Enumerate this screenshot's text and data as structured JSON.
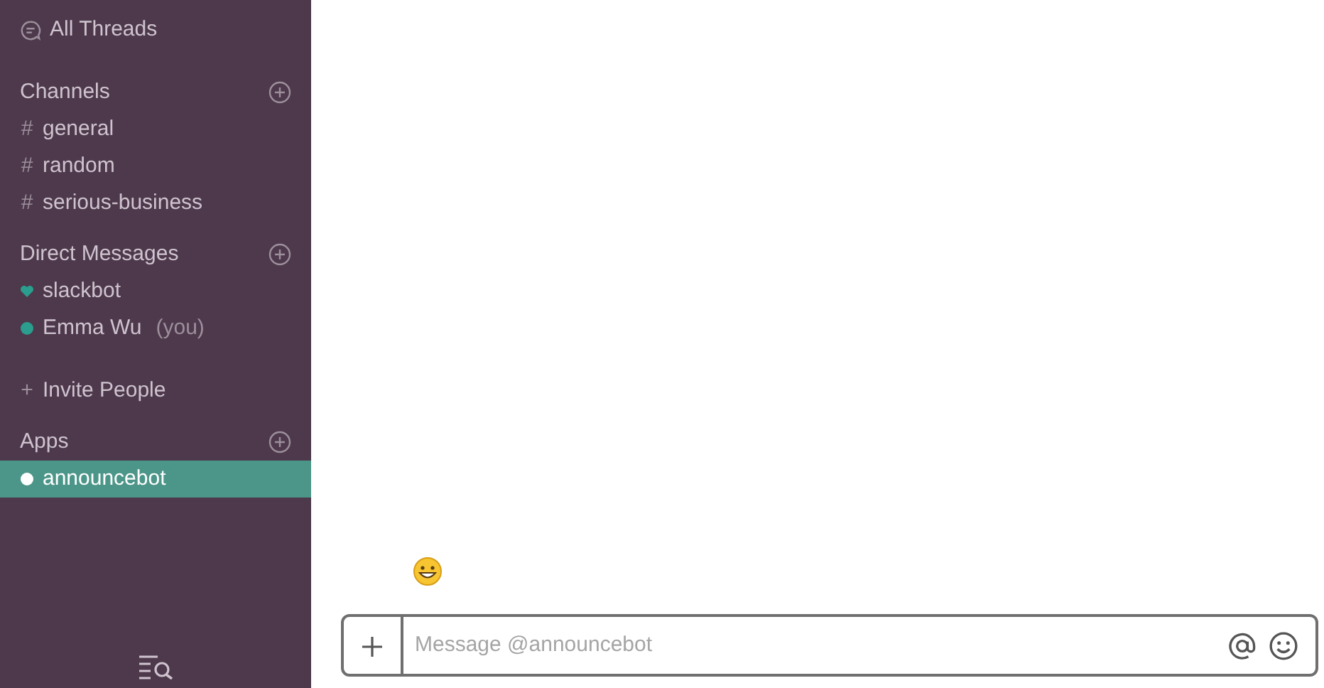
{
  "sidebar": {
    "all_threads": {
      "label": "All Threads"
    },
    "sections": [
      {
        "title": "Channels",
        "items": [
          {
            "kind": "channel",
            "prefix": "#",
            "label": "general",
            "selected": false
          },
          {
            "kind": "channel",
            "prefix": "#",
            "label": "random",
            "selected": false
          },
          {
            "kind": "channel",
            "prefix": "#",
            "label": "serious-business",
            "selected": false
          }
        ]
      },
      {
        "title": "Direct Messages",
        "items": [
          {
            "kind": "bot",
            "label": "slackbot",
            "selected": false
          },
          {
            "kind": "user",
            "label": "Emma Wu",
            "note": "(you)",
            "selected": false
          }
        ],
        "invite": {
          "prefix": "+",
          "label": "Invite People"
        }
      },
      {
        "title": "Apps",
        "items": [
          {
            "kind": "user",
            "label": "announcebot",
            "selected": true
          }
        ]
      }
    ]
  },
  "composer": {
    "placeholder": "Message @announcebot"
  }
}
